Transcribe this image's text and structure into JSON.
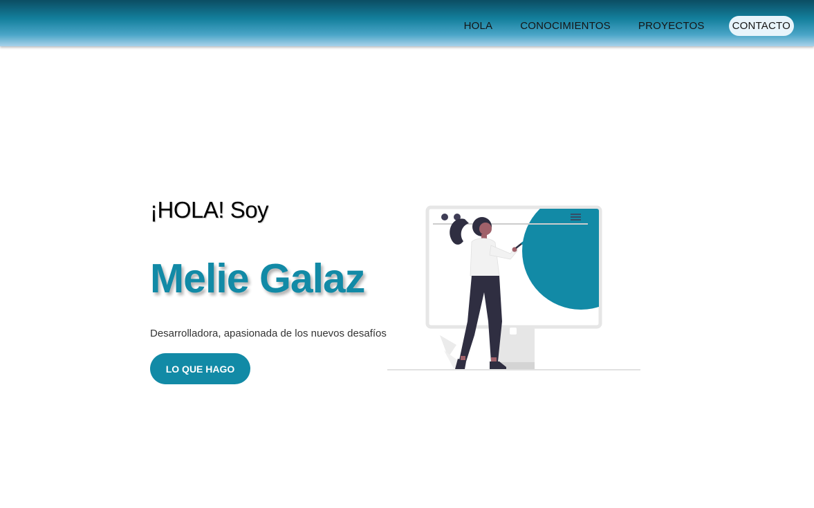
{
  "nav": {
    "items": [
      {
        "label": "HOLA"
      },
      {
        "label": "CONOCIMIENTOS"
      },
      {
        "label": "PROYECTOS"
      },
      {
        "label": "CONTACTO",
        "active": true
      }
    ]
  },
  "hero": {
    "greeting": "¡HOLA! Soy",
    "name": "Melie Galaz",
    "tagline": "Desarrolladora, apasionada de los nuevos desafíos",
    "cta_label": "LO QUE HAGO"
  },
  "colors": {
    "accent": "#128aa6",
    "nav_gradient_top": "#0b4d63",
    "nav_gradient_bottom": "#a9d2ea",
    "figure_dark": "#2f2e41"
  }
}
